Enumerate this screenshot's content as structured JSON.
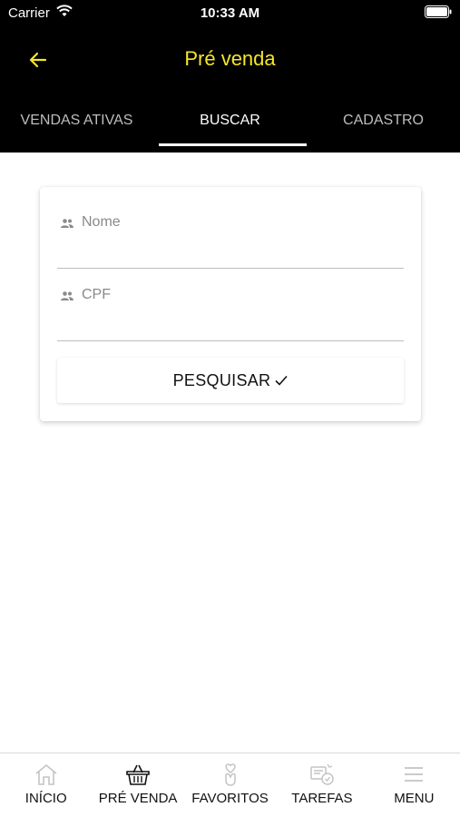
{
  "status_bar": {
    "carrier": "Carrier",
    "time": "10:33 AM"
  },
  "nav": {
    "title": "Pré venda"
  },
  "tabs": [
    {
      "label": "VENDAS ATIVAS",
      "active": false
    },
    {
      "label": "BUSCAR",
      "active": true
    },
    {
      "label": "CADASTRO",
      "active": false
    }
  ],
  "form": {
    "name_label": "Nome",
    "cpf_label": "CPF",
    "search_button": "PESQUISAR"
  },
  "bottom_nav": [
    {
      "label": "INÍCIO",
      "icon": "home-icon"
    },
    {
      "label": "PRÉ VENDA",
      "icon": "basket-icon"
    },
    {
      "label": "FAVORITOS",
      "icon": "heart-hand-icon"
    },
    {
      "label": "TAREFAS",
      "icon": "tasks-icon"
    },
    {
      "label": "MENU",
      "icon": "menu-icon"
    }
  ],
  "colors": {
    "header_bg": "#000000",
    "title_accent": "#f5e62a",
    "tab_inactive": "#bdbdbd"
  }
}
